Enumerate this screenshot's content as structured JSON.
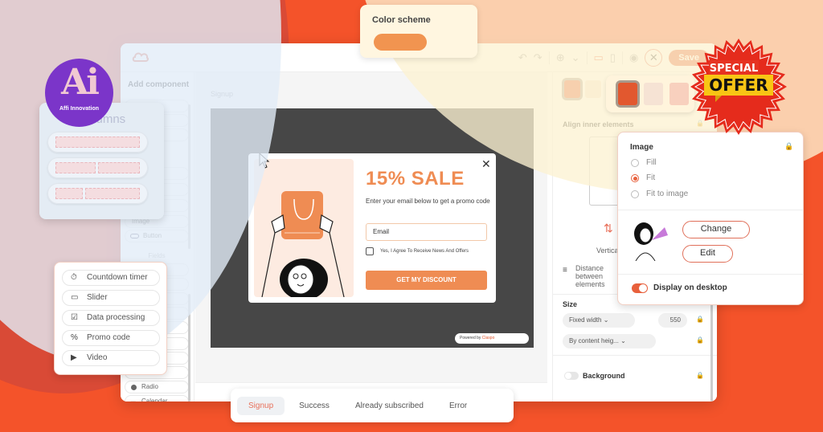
{
  "brand": {
    "logo_text": "Ai",
    "logo_subtext": "Affi Innovation"
  },
  "colors": {
    "background": "#f4532a",
    "accent": "#e8603c",
    "popup_accent": "#ef8c53",
    "badge_purple": "#7b35c9"
  },
  "toolbar": {
    "undo_icon": "↶",
    "redo_icon": "↷",
    "globe_icon": "⊕",
    "chevron_icon": "⌄",
    "desktop_icon": "▭",
    "mobile_icon": "▯",
    "preview_icon": "◉",
    "close_icon": "✕",
    "save_label": "Save"
  },
  "color_scheme": {
    "title": "Color scheme",
    "swatch": "#f19450"
  },
  "left_panel": {
    "title": "Add component",
    "items_top": [
      "",
      "",
      "",
      "",
      "",
      "",
      "",
      "",
      "Image",
      "Button"
    ],
    "fields_section": "Fields",
    "items_fields": [
      "",
      "",
      "",
      "",
      "",
      "",
      "",
      "",
      "",
      "Radio",
      "Calendar"
    ]
  },
  "columns_card": {
    "title": "Columns"
  },
  "fields_card": {
    "items": [
      {
        "icon": "⏱",
        "label": "Countdown timer"
      },
      {
        "icon": "▭",
        "label": "Slider"
      },
      {
        "icon": "☑",
        "label": "Data processing"
      },
      {
        "icon": "%",
        "label": "Promo code"
      },
      {
        "icon": "▶",
        "label": "Video"
      }
    ]
  },
  "canvas": {
    "label": "Signup"
  },
  "popup": {
    "title": "15% SALE",
    "description": "Enter your email below to get a promo code",
    "email_placeholder": "Email",
    "checkbox_label": "Yes, I Agree To Receive News And Offers",
    "cta": "GET MY DISCOUNT",
    "close": "✕",
    "powered_by": "Powered by",
    "powered_brand": "Claspo"
  },
  "right_panel": {
    "align_heading": "Align inner elements",
    "vertical_label": "Vertical",
    "distance_label": "Distance between elements",
    "size_heading": "Size",
    "width_mode": "Fixed width",
    "width_value": "550",
    "height_mode": "By content heig...",
    "background_label": "Background",
    "lock_icon": "🔒"
  },
  "image_card": {
    "title": "Image",
    "options": [
      {
        "label": "Fill",
        "checked": false
      },
      {
        "label": "Fit",
        "checked": true
      },
      {
        "label": "Fit to image",
        "checked": false
      }
    ],
    "change_label": "Change",
    "edit_label": "Edit",
    "display_label": "Display on desktop",
    "display_enabled": true
  },
  "offer_badge": {
    "line1": "SPECIAL",
    "line2": "OFFER"
  },
  "tabs": [
    {
      "label": "Signup",
      "active": true
    },
    {
      "label": "Success",
      "active": false
    },
    {
      "label": "Already subscribed",
      "active": false
    },
    {
      "label": "Error",
      "active": false
    }
  ]
}
